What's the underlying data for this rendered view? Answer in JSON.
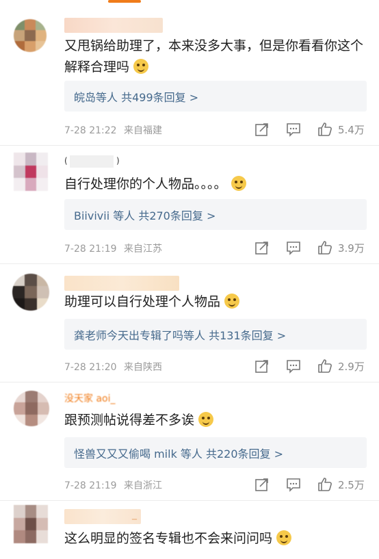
{
  "comments": [
    {
      "content": "又甩锅给助理了，本来没多大事，但是你看看你这个解释合理吗",
      "emoji_icon": "shrug-emoji-icon",
      "replies": "皖岛等人 共499条回复 >",
      "time": "7-28 21:22",
      "location": "来自福建",
      "likes": "5.4万"
    },
    {
      "username_fragment": "(",
      "username_fragment_end": ")",
      "content": "自行处理你的个人物品。。。。",
      "emoji_icon": "wink-emoji-icon",
      "replies": "Biivivii 等人 共270条回复 >",
      "time": "7-28 21:19",
      "location": "来自江苏",
      "likes": "3.9万"
    },
    {
      "content": "助理可以自行处理个人物品",
      "emoji_icon": "smile-emoji-icon",
      "replies": "龚老师今天出专辑了吗等人 共131条回复 >",
      "time": "7-28 21:20",
      "location": "来自陕西",
      "likes": "2.9万"
    },
    {
      "username_fragment": "没天家 aoi_",
      "content": "跟预测帖说得差不多诶",
      "emoji_icon": "laugh-cry-emoji-icon",
      "replies": "怪兽又又又偷喝 milk 等人 共220条回复 >",
      "time": "7-28 21:19",
      "location": "来自浙江",
      "likes": "2.5万"
    },
    {
      "username_fragment": "_",
      "content": "这么明显的签名专辑也不会来问问吗",
      "emoji_icon": "smirk-emoji-icon"
    }
  ],
  "icons": {
    "share": "share-icon",
    "comment": "comment-icon",
    "like": "thumbs-up-icon"
  },
  "colors": {
    "link": "#45698c",
    "accent": "#f07c1a"
  }
}
